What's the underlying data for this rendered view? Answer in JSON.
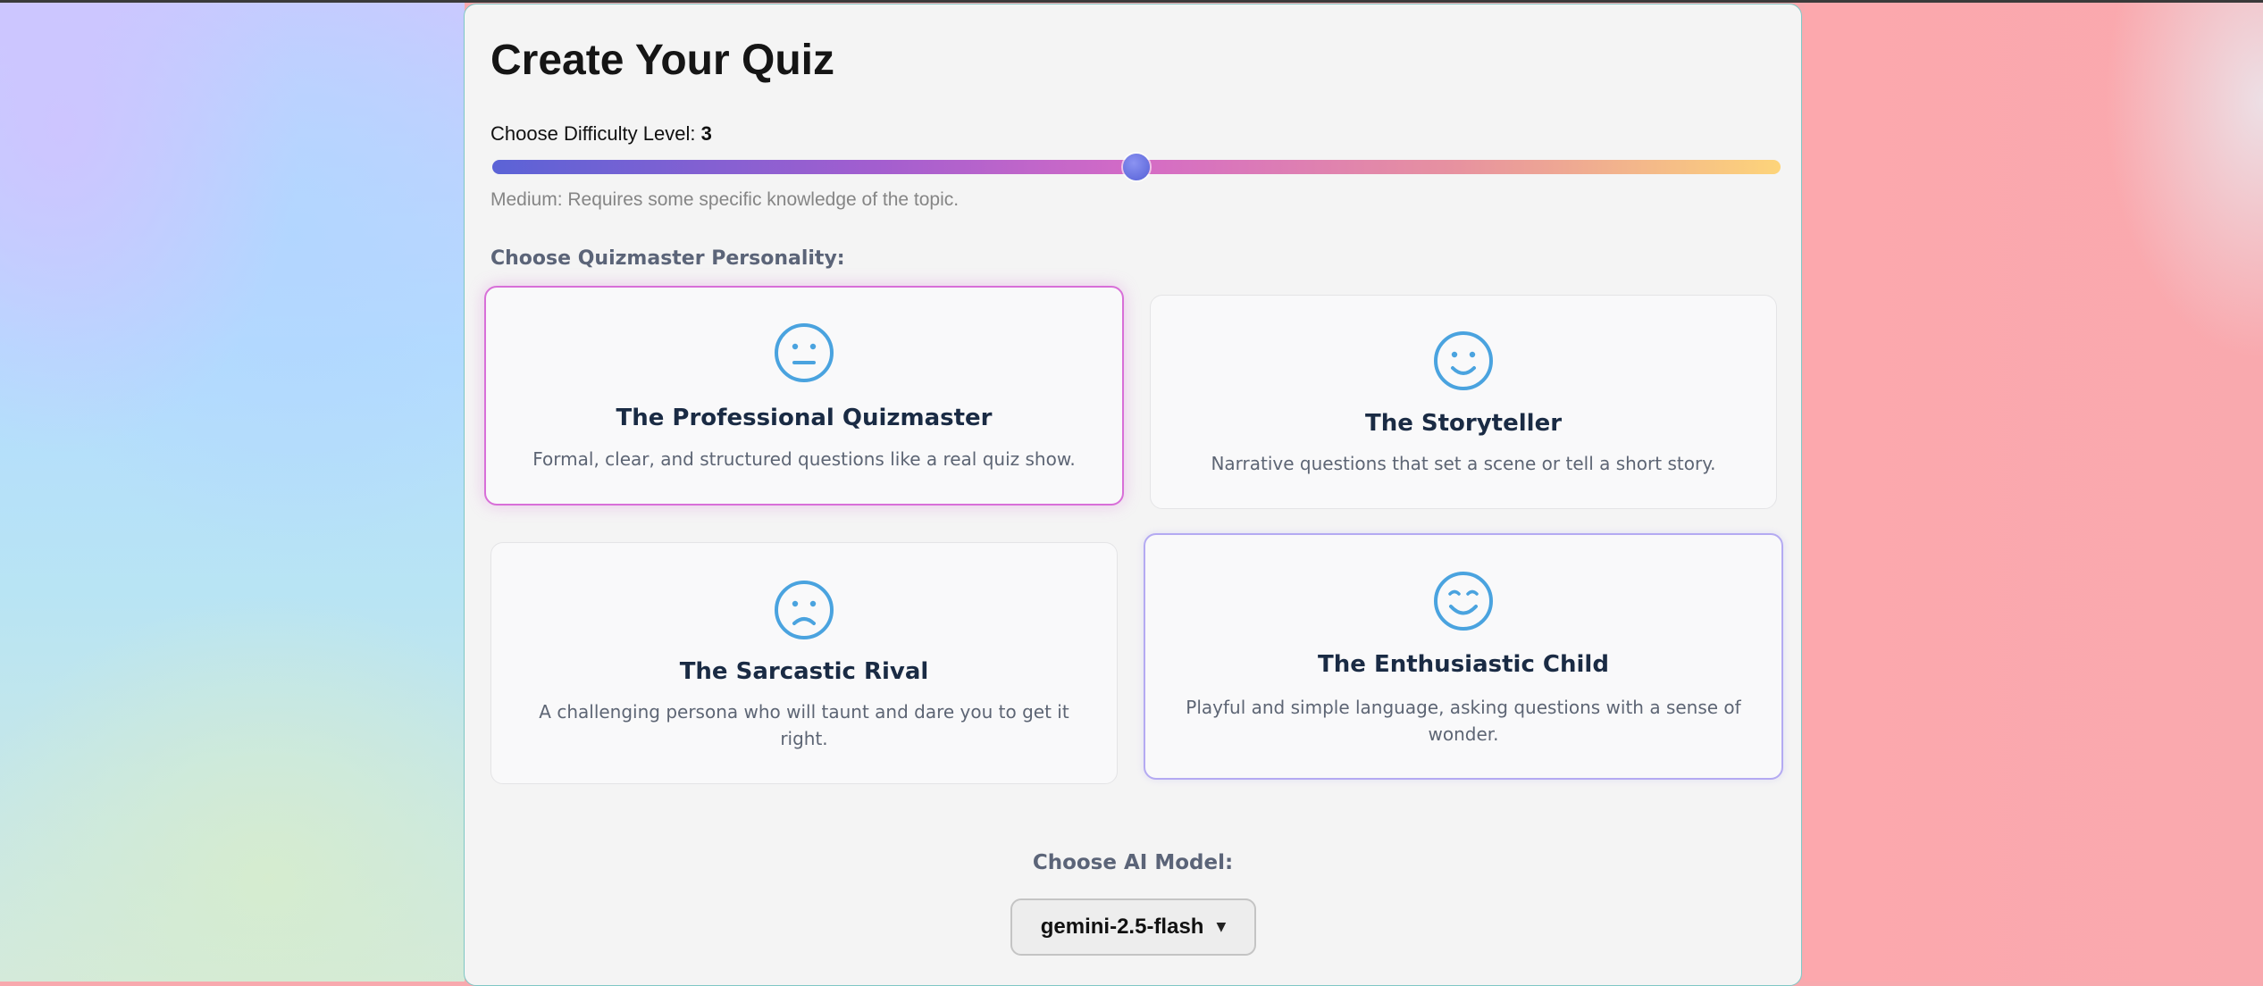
{
  "page": {
    "title": "Create Your Quiz"
  },
  "difficulty": {
    "label": "Choose Difficulty Level:",
    "value": "3",
    "level_fraction": 0.5,
    "description": "Medium: Requires some specific knowledge of the topic."
  },
  "personality": {
    "section_label": "Choose Quizmaster Personality:",
    "cards": [
      {
        "title": "The Professional Quizmaster",
        "description": "Formal, clear, and structured questions like a real quiz show.",
        "icon": "neutral-face-icon",
        "selected": true
      },
      {
        "title": "The Storyteller",
        "description": "Narrative questions that set a scene or tell a short story.",
        "icon": "smile-face-icon",
        "selected": false
      },
      {
        "title": "The Sarcastic Rival",
        "description": "A challenging persona who will taunt and dare you to get it right.",
        "icon": "frown-face-icon",
        "selected": false
      },
      {
        "title": "The Enthusiastic Child",
        "description": "Playful and simple language, asking questions with a sense of wonder.",
        "icon": "happy-face-icon",
        "selected": false
      }
    ]
  },
  "model": {
    "label": "Choose AI Model:",
    "selected": "gemini-2.5-flash",
    "caret": "▼"
  },
  "colors": {
    "icon": "#4aa3df",
    "selected_border": "#d86fd8",
    "hover_border": "#b4aaf2",
    "slider_start": "#5b63d6",
    "slider_end": "#fdd47a"
  }
}
